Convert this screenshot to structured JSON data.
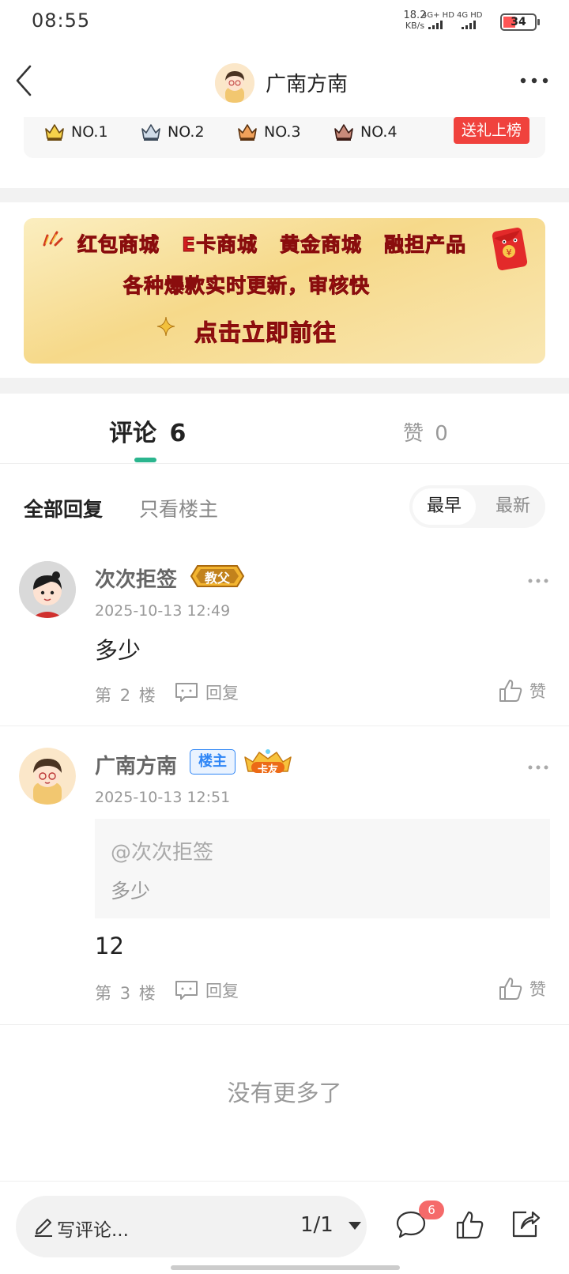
{
  "status_bar": {
    "time": "08:55",
    "net_speed_value": "18.2",
    "net_speed_unit": "KB/s",
    "sim1": "4G+ HD",
    "sim2": "4G HD",
    "battery": "34"
  },
  "header": {
    "title": "广南方南"
  },
  "rank_strip": {
    "ranks": [
      "NO.1",
      "NO.2",
      "NO.3",
      "NO.4"
    ],
    "gift_button": "送礼上榜"
  },
  "banner": {
    "line1": [
      "红包商城",
      "E卡商城",
      "黄金商城",
      "融担产品"
    ],
    "line2": "各种爆款实时更新，审核快",
    "line3": "点击立即前往"
  },
  "tabs": {
    "comments_label": "评论",
    "comments_count": "6",
    "likes_label": "赞",
    "likes_count": "0"
  },
  "filters": {
    "all": "全部回复",
    "owner_only": "只看楼主",
    "sort_oldest": "最早",
    "sort_newest": "最新"
  },
  "comments": [
    {
      "username": "次次拒签",
      "badge": "教父",
      "timestamp": "2025-10-13 12:49",
      "body": "多少",
      "floor_prefix": "第",
      "floor_num": "2",
      "floor_suffix": "楼",
      "reply_label": "回复",
      "like_label": "赞"
    },
    {
      "username": "广南方南",
      "owner_tag": "楼主",
      "badge": "卡友",
      "timestamp": "2025-10-13 12:51",
      "quote_user": "@次次拒签",
      "quote_body": "多少",
      "body": "12",
      "floor_prefix": "第",
      "floor_num": "3",
      "floor_suffix": "楼",
      "reply_label": "回复",
      "like_label": "赞"
    }
  ],
  "no_more": "没有更多了",
  "bottom_bar": {
    "composer_placeholder": "写评论...",
    "page": "1/1",
    "comment_badge": "6"
  },
  "colors": {
    "accent_green": "#2bb58e",
    "gift_red": "#f0423d",
    "owner_blue": "#2f86f6",
    "badge_red": "#f56a6a"
  }
}
